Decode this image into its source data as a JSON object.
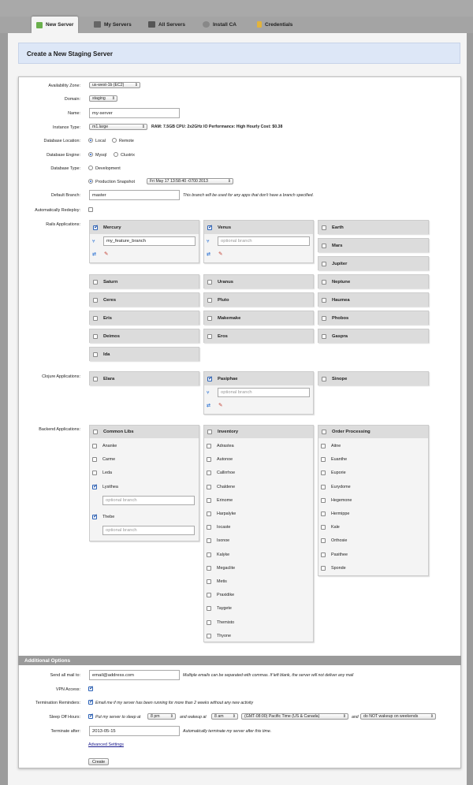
{
  "tabs": [
    {
      "label": "New Server",
      "icon": "plus-icon"
    },
    {
      "label": "My Servers",
      "icon": "server-icon"
    },
    {
      "label": "All Servers",
      "icon": "servers-icon"
    },
    {
      "label": "Install CA",
      "icon": "plug-icon"
    },
    {
      "label": "Credentials",
      "icon": "key-icon"
    }
  ],
  "page_title": "Create a New Staging Server",
  "form": {
    "availability_zone": {
      "label": "Availability Zone:",
      "value": "us-west-1b (EC2)"
    },
    "domain": {
      "label": "Domain:",
      "value": "staging"
    },
    "name": {
      "label": "Name:",
      "value": "my-server"
    },
    "instance_type": {
      "label": "Instance Type:",
      "value": "m1.large",
      "specs": "RAM: 7.5GB   CPU: 2x2GHz   IO Performance: High   Hourly Cost: $0.38"
    },
    "database_location": {
      "label": "Database Location:",
      "options": [
        "Local",
        "Remote"
      ]
    },
    "database_engine": {
      "label": "Database Engine:",
      "options": [
        "Mysql",
        "Clustrix"
      ]
    },
    "database_type": {
      "label": "Database Type:",
      "options": [
        "Development",
        "Production Snapshot"
      ],
      "snapshot": "Fri May 17 13:58:40 -0700 2013"
    },
    "default_branch": {
      "label": "Default Branch:",
      "value": "master",
      "note": "This branch will be used for any apps that don't have a branch specified."
    },
    "auto_redeploy": {
      "label": "Automatically Redeploy:"
    }
  },
  "rails": {
    "label": "Rails Applications:",
    "mercury": {
      "name": "Mercury",
      "branch": "my_feature_branch"
    },
    "venus": {
      "name": "Venus",
      "branch_placeholder": "optional branch"
    },
    "others": [
      "Earth",
      "Mars",
      "Jupiter",
      "Saturn",
      "Uranus",
      "Neptune",
      "Ceres",
      "Pluto",
      "Haumea",
      "Eris",
      "Makemake",
      "Phobos",
      "Deimos",
      "Eros",
      "Gaspra",
      "Ida"
    ]
  },
  "clojure": {
    "label": "Clojure Applications:",
    "apps": [
      "Elara",
      "Pasiphae",
      "Sinope"
    ],
    "branch_placeholder": "optional branch"
  },
  "backend": {
    "label": "Backend Applications:",
    "common": {
      "title": "Common Libs",
      "items": [
        "Ananke",
        "Carme",
        "Leda",
        "Lysithea",
        "Thebe"
      ],
      "placeholder": "optional branch"
    },
    "inventory": {
      "title": "Inventory",
      "items": [
        "Adrastea",
        "Autonoe",
        "Callirrhoe",
        "Chaldene",
        "Erinome",
        "Harpalyke",
        "Iocaste",
        "Isonoe",
        "Kalyke",
        "Megaclite",
        "Metis",
        "Praxidike",
        "Taygete",
        "Themisto",
        "Thyone"
      ]
    },
    "orders": {
      "title": "Order Processing",
      "items": [
        "Aitne",
        "Euanthe",
        "Euporie",
        "Eurydome",
        "Hegemone",
        "Hermippe",
        "Kale",
        "Orthosie",
        "Pasithee",
        "Sponde"
      ]
    }
  },
  "additional": {
    "title": "Additional Options",
    "mail": {
      "label": "Send all mail to:",
      "value": "email@address.com",
      "note": "Multiple emails can be separated with commas. If left blank, the server will not deliver any mail"
    },
    "vpn": {
      "label": "VPN Access:"
    },
    "reminders": {
      "label": "Termination Reminders:",
      "text": "Email me if my server has been running for more than 2 weeks without any new activity"
    },
    "sleep": {
      "label": "Sleep Off Hours:",
      "text1": "Put my server to sleep at",
      "sleep_at": "8 pm",
      "text2": "and wakeup at",
      "wake_at": "8 am",
      "tz": "(GMT-08:00) Pacific Time (US & Canada)",
      "text3": "and",
      "weekends": "do NOT wakeup on weekends"
    },
    "terminate": {
      "label": "Terminate after:",
      "value": "2013-05-15",
      "note": "Automatically terminate my server after this time."
    },
    "advanced": "Advanced Settings",
    "create": "Create"
  }
}
